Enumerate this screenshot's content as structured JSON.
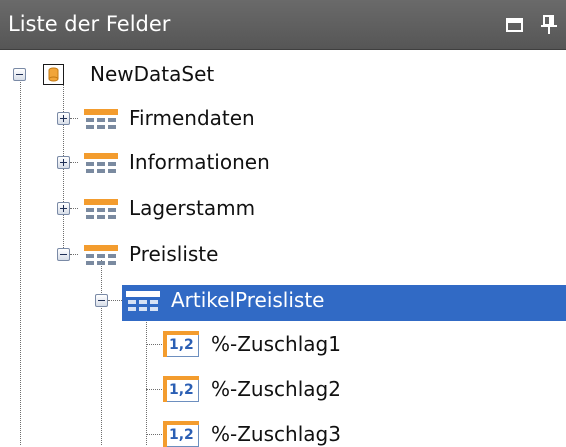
{
  "panel": {
    "title": "Liste der Felder",
    "buttons": {
      "minimize_icon": "window-minimize-icon",
      "pin_icon": "pin-icon"
    }
  },
  "tree": {
    "root": {
      "label": "NewDataSet",
      "icon": "database-icon",
      "expanded": true
    },
    "tables": [
      {
        "label": "Firmendaten",
        "icon": "table-icon",
        "expanded": false
      },
      {
        "label": "Informationen",
        "icon": "table-icon",
        "expanded": false
      },
      {
        "label": "Lagerstamm",
        "icon": "table-icon",
        "expanded": false
      },
      {
        "label": "Preisliste",
        "icon": "table-icon",
        "expanded": true
      }
    ],
    "selected": {
      "label": "ArtikelPreisliste",
      "icon": "table-icon",
      "expanded": true
    },
    "fields": [
      {
        "label": "%-Zuschlag1",
        "icon": "numeric-field-icon",
        "icon_text": "1,2"
      },
      {
        "label": "%-Zuschlag2",
        "icon": "numeric-field-icon",
        "icon_text": "1,2"
      },
      {
        "label": "%-Zuschlag3",
        "icon": "numeric-field-icon",
        "icon_text": "1,2"
      }
    ]
  },
  "colors": {
    "titlebar": "#5e5e5e",
    "selection": "#316ac5",
    "table_icon_header": "#f39c2e",
    "numeric_icon_text": "#2b5fb4"
  }
}
